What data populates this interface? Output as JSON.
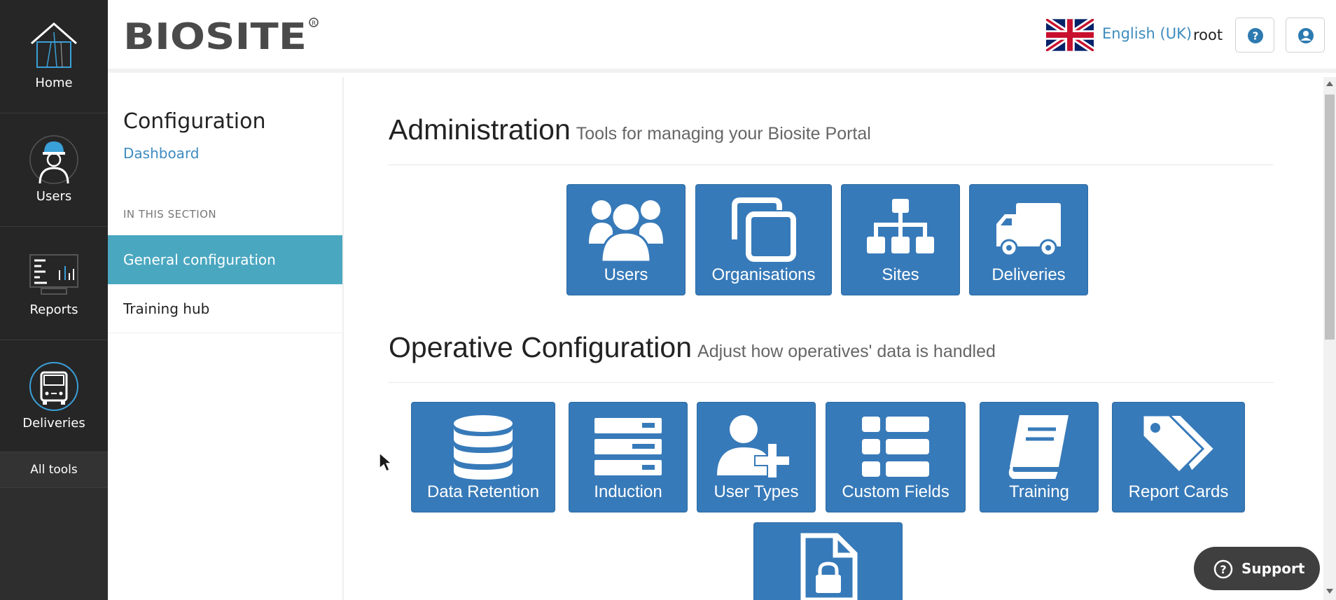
{
  "rail": {
    "items": [
      {
        "label": "Home",
        "icon": "home-icon"
      },
      {
        "label": "Users",
        "icon": "worker-icon"
      },
      {
        "label": "Reports",
        "icon": "reports-icon"
      },
      {
        "label": "Deliveries",
        "icon": "truck-icon"
      }
    ],
    "all_tools": "All tools"
  },
  "header": {
    "logo_text": "BIOSITE",
    "language": "English (UK)",
    "username": "root",
    "help_icon": "question-circle-icon",
    "account_icon": "user-circle-icon"
  },
  "sidebar": {
    "title": "Configuration",
    "dashboard_link": "Dashboard",
    "section_label": "IN THIS SECTION",
    "items": [
      {
        "label": "General configuration",
        "active": true
      },
      {
        "label": "Training hub",
        "active": false
      }
    ]
  },
  "main": {
    "administration": {
      "title": "Administration",
      "subtitle": "Tools for managing your Biosite Portal",
      "tiles": [
        {
          "label": "Users",
          "icon": "users-group-icon"
        },
        {
          "label": "Organisations",
          "icon": "clone-icon"
        },
        {
          "label": "Sites",
          "icon": "sitemap-icon"
        },
        {
          "label": "Deliveries",
          "icon": "truck-icon"
        }
      ]
    },
    "operative": {
      "title": "Operative Configuration",
      "subtitle": "Adjust how operatives' data is handled",
      "tiles": [
        {
          "label": "Data Retention",
          "icon": "database-icon"
        },
        {
          "label": "Induction",
          "icon": "server-icon"
        },
        {
          "label": "User Types",
          "icon": "user-plus-icon"
        },
        {
          "label": "Custom Fields",
          "icon": "list-icon"
        },
        {
          "label": "Training",
          "icon": "book-icon"
        },
        {
          "label": "Report Cards",
          "icon": "tags-icon"
        },
        {
          "label": "",
          "icon": "file-lock-icon"
        }
      ]
    }
  },
  "support": {
    "label": "Support"
  },
  "colors": {
    "tile": "#377ab9",
    "active": "#4aa7c0",
    "link": "#3d8bbf",
    "rail": "#262626"
  }
}
